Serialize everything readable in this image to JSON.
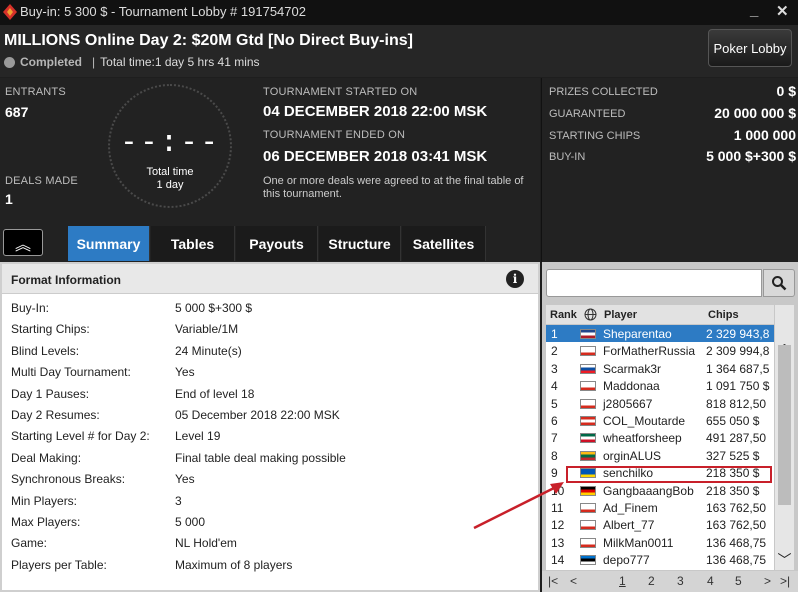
{
  "titlebar": {
    "title": "Buy-in: 5 300 $ - Tournament Lobby # 191754702",
    "minimize": "_",
    "close": "✕"
  },
  "header": {
    "tournament_name": "MILLIONS Online Day 2: $20M Gtd [No Direct Buy-ins]",
    "status": "Completed",
    "separator": "|",
    "total_time": "Total time:1 day 5 hrs  41 mins",
    "lobby_button": "Poker Lobby"
  },
  "info": {
    "entrants_label": "ENTRANTS",
    "entrants_value": "687",
    "deals_label": "DEALS MADE",
    "deals_value": "1",
    "clock_digits": "--:--",
    "clock_caption_1": "Total time",
    "clock_caption_2": "1 day",
    "started_label": "TOURNAMENT STARTED ON",
    "started_value": "04 DECEMBER 2018  22:00 MSK",
    "ended_label": "TOURNAMENT ENDED ON",
    "ended_value": "06 DECEMBER 2018  03:41 MSK",
    "note": "One or more deals were agreed to at the final table of this tournament."
  },
  "prizes": [
    {
      "label": "PRIZES COLLECTED",
      "value": "0 $"
    },
    {
      "label": "GUARANTEED",
      "value": "20 000 000 $"
    },
    {
      "label": "STARTING CHIPS",
      "value": "1 000 000"
    },
    {
      "label": "BUY-IN",
      "value": "5 000 $+300 $"
    }
  ],
  "tabs": [
    {
      "label": "Summary",
      "active": true
    },
    {
      "label": "Tables",
      "active": false
    },
    {
      "label": "Payouts",
      "active": false
    },
    {
      "label": "Structure",
      "active": false
    },
    {
      "label": "Satellites",
      "active": false
    }
  ],
  "collapse_icon": "double-chevron-up-icon",
  "collapse_glyph": "︽",
  "format": {
    "title": "Format Information",
    "info_glyph": "i",
    "rows": [
      {
        "key": "Buy-In:",
        "value": "5 000 $+300 $"
      },
      {
        "key": "Starting Chips:",
        "value": "Variable/1M"
      },
      {
        "key": "Blind Levels:",
        "value": "24 Minute(s)"
      },
      {
        "key": "Multi Day Tournament:",
        "value": "Yes"
      },
      {
        "key": "Day 1 Pauses:",
        "value": "End of level 18"
      },
      {
        "key": "Day 2 Resumes:",
        "value": "05 December 2018  22:00 MSK"
      },
      {
        "key": "Starting Level # for Day 2:",
        "value": "Level 19"
      },
      {
        "key": "Deal Making:",
        "value": "Final table deal making possible"
      },
      {
        "key": "Synchronous Breaks:",
        "value": "Yes"
      },
      {
        "key": "Min Players:",
        "value": "3"
      },
      {
        "key": "Max Players:",
        "value": "5 000"
      },
      {
        "key": "Game:",
        "value": "NL Hold'em"
      },
      {
        "key": "Players per Table:",
        "value": "Maximum of 8 players"
      }
    ]
  },
  "players": {
    "search_placeholder": "",
    "columns": {
      "rank": "Rank",
      "player": "Player",
      "chips": "Chips"
    },
    "rows": [
      {
        "rank": "1",
        "flag": [
          "#21468b",
          "#ffffff",
          "#ae1c28"
        ],
        "name": "Sheparentao",
        "chips": "2 329 943,8",
        "selected": true
      },
      {
        "rank": "2",
        "flag": [
          "#ffffff",
          "#ffffff",
          "#d52b1e"
        ],
        "name": "ForMatherRussia",
        "chips": "2 309 994,8",
        "selected": false
      },
      {
        "rank": "3",
        "flag": [
          "#ffffff",
          "#0b4ea2",
          "#ee1c25"
        ],
        "name": "Scarmak3r",
        "chips": "1 364 687,5",
        "selected": false
      },
      {
        "rank": "4",
        "flag": [
          "#ffffff",
          "#ffffff",
          "#d52b1e"
        ],
        "name": "Maddonaa",
        "chips": "1 091 750 $",
        "selected": false
      },
      {
        "rank": "5",
        "flag": [
          "#ffffff",
          "#ffffff",
          "#d52b1e"
        ],
        "name": "j2805667",
        "chips": "818 812,50",
        "selected": false
      },
      {
        "rank": "6",
        "flag": [
          "#d52b1e",
          "#ffffff",
          "#d52b1e"
        ],
        "name": "COL_Moutarde",
        "chips": "655 050 $",
        "selected": false
      },
      {
        "rank": "7",
        "flag": [
          "#006847",
          "#ffffff",
          "#ce1126"
        ],
        "name": "wheatforsheep",
        "chips": "491 287,50",
        "selected": false
      },
      {
        "rank": "8",
        "flag": [
          "#fdb913",
          "#006a44",
          "#c1272d"
        ],
        "name": "orginALUS",
        "chips": "327 525 $",
        "selected": false
      },
      {
        "rank": "9",
        "flag": [
          "#0057b7",
          "#0057b7",
          "#ffd700"
        ],
        "name": "senchilko",
        "chips": "218 350 $",
        "selected": false
      },
      {
        "rank": "10",
        "flag": [
          "#000000",
          "#dd0000",
          "#ffce00"
        ],
        "name": "GangbaaangBob",
        "chips": "218 350 $",
        "selected": false
      },
      {
        "rank": "11",
        "flag": [
          "#ffffff",
          "#ffffff",
          "#d52b1e"
        ],
        "name": "Ad_Finem",
        "chips": "163 762,50",
        "selected": false
      },
      {
        "rank": "12",
        "flag": [
          "#ffffff",
          "#ffffff",
          "#d52b1e"
        ],
        "name": "Albert_77",
        "chips": "163 762,50",
        "selected": false
      },
      {
        "rank": "13",
        "flag": [
          "#ffffff",
          "#ffffff",
          "#d52b1e"
        ],
        "name": "MilkMan0011",
        "chips": "136 468,75",
        "selected": false
      },
      {
        "rank": "14",
        "flag": [
          "#0072ce",
          "#000000",
          "#ffffff"
        ],
        "name": "depo777",
        "chips": "136 468,75",
        "selected": false
      }
    ],
    "pager": {
      "first": "|<",
      "prev": "<",
      "pages": [
        "1",
        "2",
        "3",
        "4",
        "5"
      ],
      "current": "1",
      "next": ">",
      "last": ">|"
    }
  },
  "colors": {
    "accent": "#2d7bc4",
    "highlight_box": "#c8202a",
    "background": "#1e1e1e"
  }
}
